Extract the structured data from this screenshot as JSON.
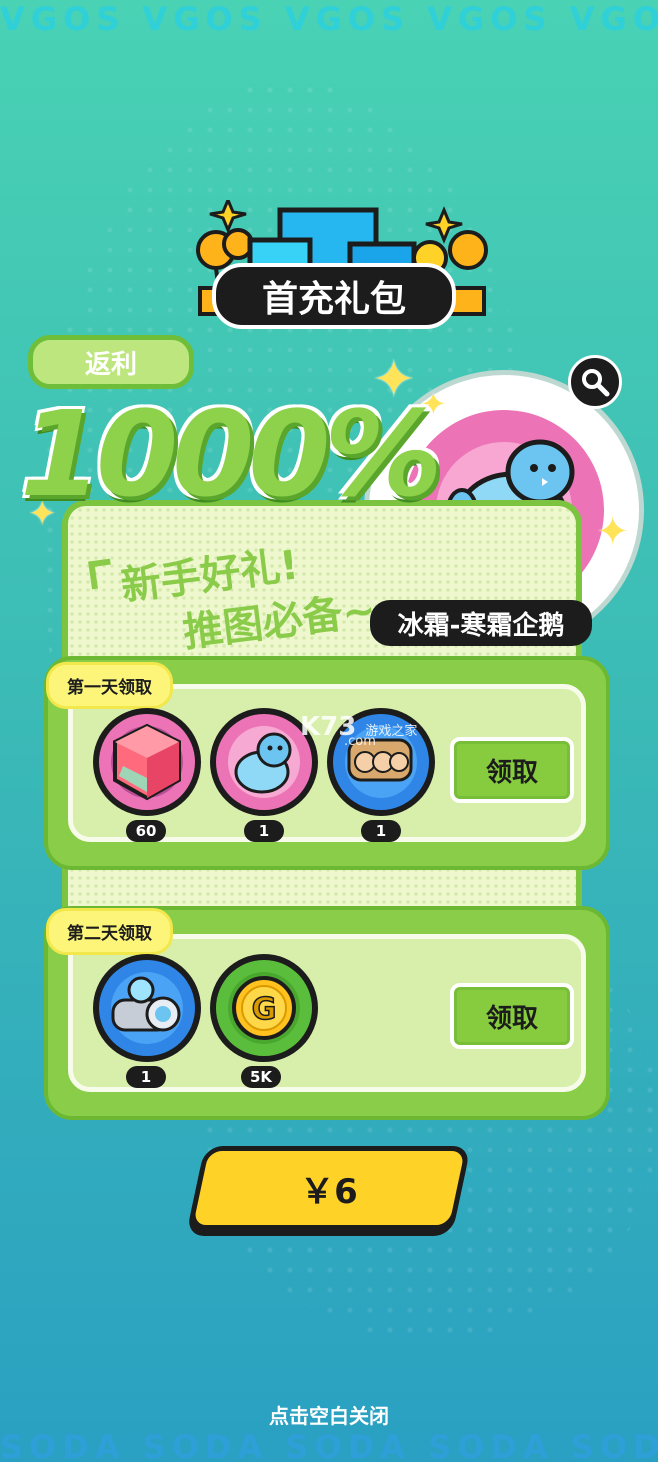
{
  "top_pattern": "VGOS VGOS VGOS VGOS VGOS",
  "bottom_pattern": "SODA SODA SODA SODA SODA",
  "title": "首充礼包",
  "rebate_label": "返利",
  "rebate_value": "1000%",
  "slogan_line1": "新手好礼!",
  "slogan_line2": "推图必备~",
  "pet_name": "冰霜-寒霜企鹅",
  "watermark": {
    "main": "K73",
    "sub": "游戏之家",
    "domain": ".com"
  },
  "day1": {
    "label": "第一天领取",
    "rewards": [
      {
        "icon": "crystal-cube-icon",
        "count": "60"
      },
      {
        "icon": "penguin-pet-icon",
        "count": "1"
      },
      {
        "icon": "fist-gauntlet-icon",
        "count": "1"
      }
    ],
    "claim_label": "领取"
  },
  "day2": {
    "label": "第二天领取",
    "rewards": [
      {
        "icon": "frost-device-icon",
        "count": "1"
      },
      {
        "icon": "gold-coin-icon",
        "count": "5K"
      }
    ],
    "claim_label": "领取"
  },
  "price_label": "￥6",
  "close_hint": "点击空白关闭",
  "colors": {
    "accent_green": "#8acd48",
    "price_yellow": "#ffd228",
    "pink": "#ec74b6"
  }
}
